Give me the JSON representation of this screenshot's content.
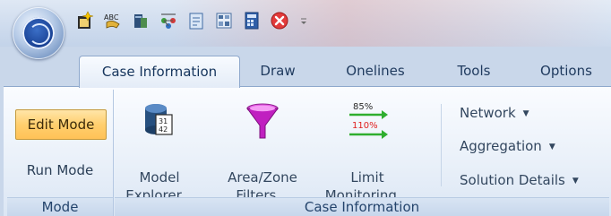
{
  "tabs": [
    {
      "label": "Case Information",
      "active": true
    },
    {
      "label": "Draw",
      "active": false
    },
    {
      "label": "Onelines",
      "active": false
    },
    {
      "label": "Tools",
      "active": false
    },
    {
      "label": "Options",
      "active": false
    }
  ],
  "quick_access_icons": [
    "new-case-icon",
    "abc-tool-icon",
    "database-icon",
    "network-icon",
    "clipboard-icon",
    "grid-icon",
    "calculator-icon",
    "close-icon",
    "customize-icon"
  ],
  "ribbon": {
    "mode_group": {
      "label": "Mode",
      "buttons": [
        {
          "label": "Edit Mode",
          "selected": true
        },
        {
          "label": "Run Mode",
          "selected": false
        }
      ]
    },
    "case_info_group": {
      "label": "Case Information",
      "big_buttons": [
        {
          "line1": "Model",
          "line2": "Explorer..."
        },
        {
          "line1": "Area/Zone",
          "line2": "Filters..."
        },
        {
          "line1": "Limit",
          "line2": "Monitoring..."
        }
      ],
      "limit_icon_text": {
        "top": "85%",
        "bottom": "110%"
      },
      "small_buttons": [
        {
          "label": "Network"
        },
        {
          "label": "Aggregation"
        },
        {
          "label": "Solution Details"
        }
      ]
    }
  },
  "colors": {
    "selected_mode": "#ffcf6e",
    "funnel": "#c020c0",
    "ribbon_bg": "#eef3fa"
  }
}
